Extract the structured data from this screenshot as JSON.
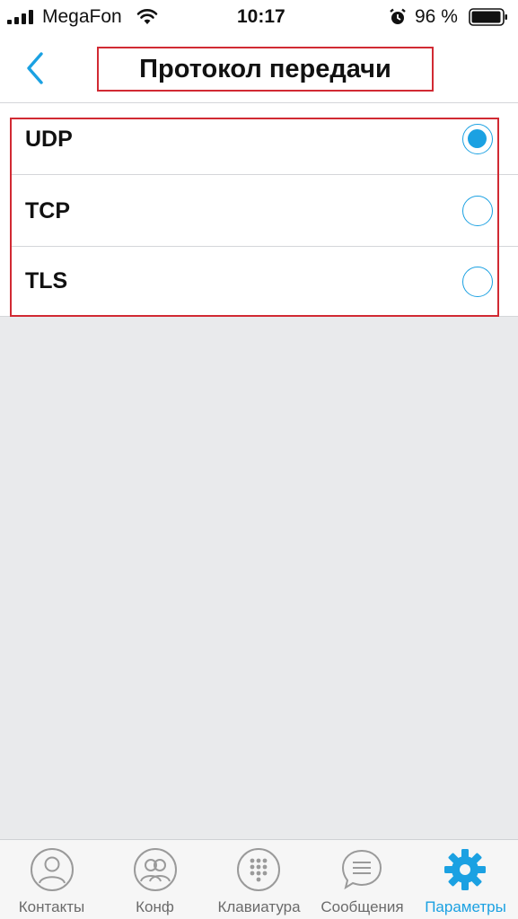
{
  "status_bar": {
    "carrier": "MegaFon",
    "time": "10:17",
    "battery": "96 %",
    "icons": [
      "signal-icon",
      "wifi-icon",
      "alarm-icon",
      "battery-icon"
    ]
  },
  "header": {
    "title": "Протокол передачи",
    "back_icon": "chevron-left-icon"
  },
  "options": [
    {
      "label": "UDP",
      "selected": true
    },
    {
      "label": "TCP",
      "selected": false
    },
    {
      "label": "TLS",
      "selected": false
    }
  ],
  "tabbar": {
    "tabs": [
      {
        "label": "Контакты",
        "icon": "person-icon",
        "active": false
      },
      {
        "label": "Конф",
        "icon": "group-icon",
        "active": false
      },
      {
        "label": "Клавиатура",
        "icon": "dialpad-icon",
        "active": false
      },
      {
        "label": "Сообщения",
        "icon": "chat-bubble-icon",
        "active": false
      },
      {
        "label": "Параметры",
        "icon": "gear-icon",
        "active": true
      }
    ]
  },
  "colors": {
    "accent": "#1ba1e2",
    "highlight_box": "#d12a33",
    "background": "#e9eaec"
  }
}
